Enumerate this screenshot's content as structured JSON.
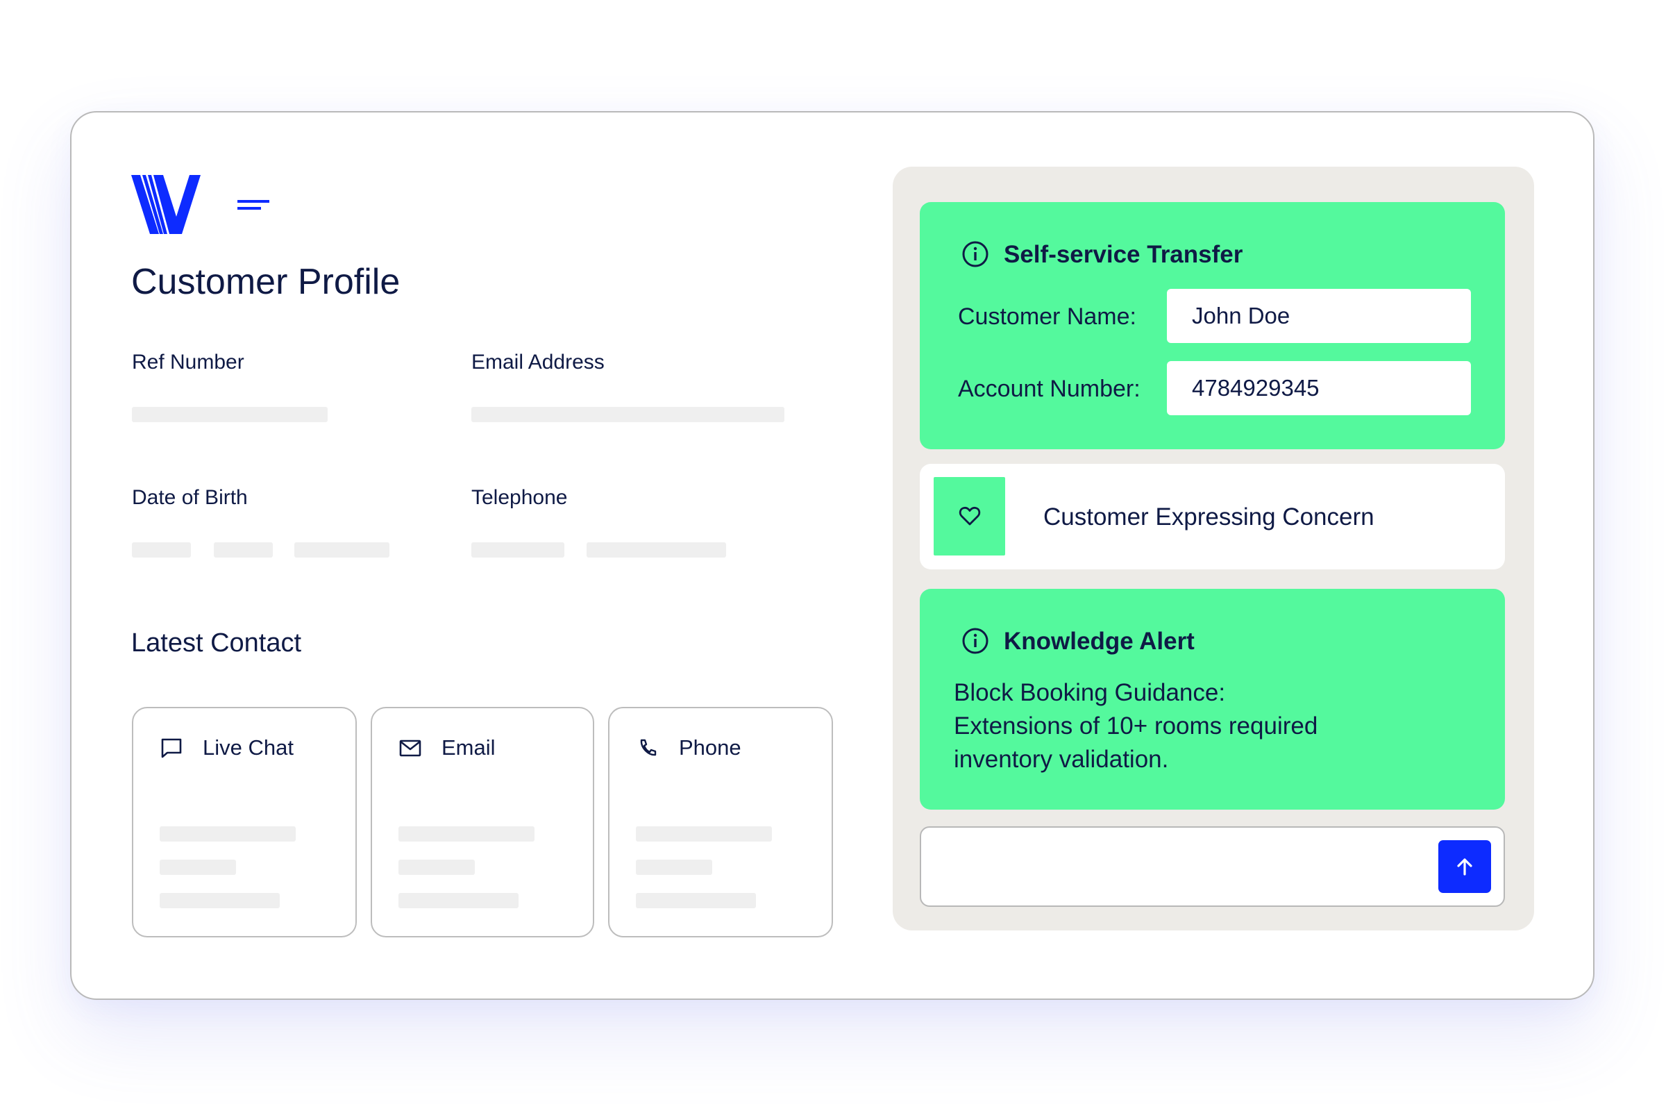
{
  "header": {
    "logo_icon": "v-logo-icon",
    "menu_icon": "menu-icon",
    "page_title": "Customer Profile"
  },
  "profile": {
    "ref_number_label": "Ref Number",
    "email_label": "Email Address",
    "dob_label": "Date of Birth",
    "telephone_label": "Telephone"
  },
  "latest_contact": {
    "title": "Latest Contact",
    "channels": [
      {
        "label": "Live Chat",
        "icon": "chat-bubble-icon"
      },
      {
        "label": "Email",
        "icon": "envelope-icon"
      },
      {
        "label": "Phone",
        "icon": "phone-icon"
      }
    ]
  },
  "transfer": {
    "title": "Self-service Transfer",
    "icon": "info-icon",
    "customer_name_label": "Customer Name:",
    "customer_name_value": "John Doe",
    "account_number_label": "Account Number:",
    "account_number_value": "4784929345"
  },
  "sentiment": {
    "icon": "heart-icon",
    "text": "Customer Expressing Concern"
  },
  "knowledge_alert": {
    "title": "Knowledge Alert",
    "icon": "info-icon",
    "lines": [
      "Block Booking Guidance:",
      "Extensions of 10+ rooms required",
      "inventory validation."
    ]
  },
  "composer": {
    "value": "",
    "send_icon": "arrow-up-icon"
  },
  "colors": {
    "brand_blue": "#0d2bff",
    "accent_green": "#54f99d",
    "text_navy": "#0f1a45",
    "panel_gray": "#edebe7"
  }
}
